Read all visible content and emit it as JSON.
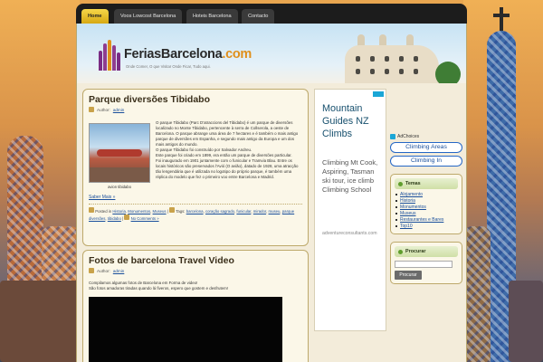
{
  "nav": {
    "items": [
      {
        "label": "Home"
      },
      {
        "label": "Voos Lowcost Barcelona"
      },
      {
        "label": "Hoteis Barcelona"
      },
      {
        "label": "Contacto"
      }
    ]
  },
  "header": {
    "logo_main": "FeriasBarcelona",
    "logo_accent": ".com",
    "tagline": "Onde Comer, O que Visitar Onde Ficar, Tudo aqui."
  },
  "posts": [
    {
      "title": "Parque diversões Tibidabo",
      "author_label": "Author:",
      "author": "admin",
      "thumb_caption": "avion tibidabo",
      "paragraphs": [
        "O parque Tibidabo (Parc D'atraccions del Tibidabo) é um parque de diversões localizado no Monte Tibidabo, pertencente à serra de Collserola, a oeste de Barcelona. O parque abrange uma área de 7 hectares e é também o mais antigo parque de diversões em Espanha, e segundo mais antigo da Europa e um dos mais antigos do mundo.",
        "O parque Tibidabo foi construído por Salvador Andreu.",
        "Este parque foi criado em 1899, era então um parque de diversões particular.",
        "Foi inaugurado em 1901 juntamente com o funicular e Tramvia Blau. Entre os locais históricos são preservados l'Avió (O avião), datado de 1928, uma atracção tão lengendária que é utilizada no logotipo do próprio parque, é também uma réplica do modelo que fez o primeiro voo entre Barcelona e Madrid."
      ],
      "read_more": "Saber Mais »",
      "posted_in_label": "Posted in",
      "categories": [
        "Historia",
        "Monumentos",
        "Museus"
      ],
      "tags_label": "Tags:",
      "tags": [
        "barcelona",
        "coração sagrado",
        "funicular",
        "mirador",
        "museu",
        "parque diversões",
        "tibidabo"
      ],
      "comments": "No Comments »"
    },
    {
      "title": "Fotos de barcelona Travel Video",
      "author_label": "Author:",
      "author": "admin",
      "paragraphs": [
        "Compilamos algumas fotos de Barcelona em Forma de video!",
        "São fotos amadoras tiradas quando lá fiveros, espero que gostem e desfrutem!"
      ]
    }
  ],
  "ad": {
    "title": "Mountain Guides NZ Climbs",
    "description": "Climbing Mt Cook, Aspiring, Tasman ski tour, ice climb Climbing School",
    "url": "adventureconsultants.com"
  },
  "sidebar": {
    "adchoices": "AdChoices",
    "ad_links": [
      "Climbing Areas",
      "Climbing In"
    ],
    "temas": {
      "title": "Temas",
      "items": [
        "Alojamento",
        "Historia",
        "Monumentos",
        "Museus",
        "Restaurantes e Bares",
        "Top10"
      ]
    },
    "search": {
      "title": "Procurar",
      "button": "Procurar"
    }
  }
}
